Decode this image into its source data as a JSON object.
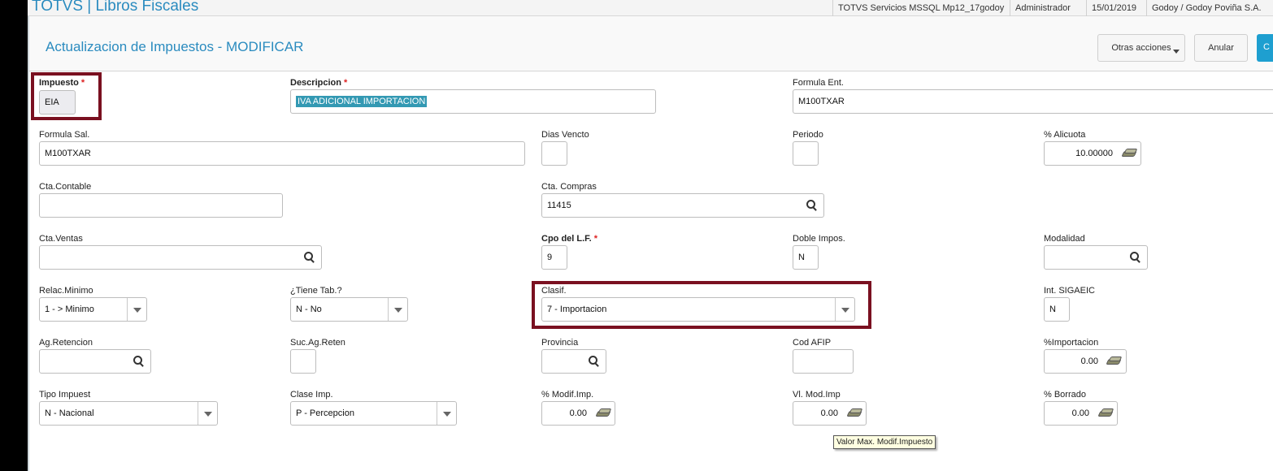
{
  "app": {
    "title": "TOTVS | Libros Fiscales",
    "server": "TOTVS Servicios MSSQL Mp12_17godoy",
    "user": "Administrador",
    "date": "15/01/2019",
    "company": "Godoy / Godoy Poviña S.A."
  },
  "header": {
    "title": "Actualizacion de Impuestos - MODIFICAR",
    "other_actions": "Otras acciones",
    "cancel": "Anular",
    "confirm": "C"
  },
  "form": {
    "impuesto": {
      "label": "Impuesto",
      "value": "EIA"
    },
    "descripcion": {
      "label": "Descripcion",
      "value": "IVA ADICIONAL IMPORTACION"
    },
    "formula_ent": {
      "label": "Formula Ent.",
      "value": "M100TXAR"
    },
    "formula_sal": {
      "label": "Formula Sal.",
      "value": "M100TXAR"
    },
    "dias_vencto": {
      "label": "Dias Vencto",
      "value": ""
    },
    "periodo": {
      "label": "Periodo",
      "value": ""
    },
    "alicuota": {
      "label": "% Alicuota",
      "value": "10.00000"
    },
    "cta_contable": {
      "label": "Cta.Contable",
      "value": ""
    },
    "cta_compras": {
      "label": "Cta. Compras",
      "value": "11415"
    },
    "cta_ventas": {
      "label": "Cta.Ventas",
      "value": ""
    },
    "cpo_lf": {
      "label": "Cpo del L.F.",
      "value": "9"
    },
    "doble_impos": {
      "label": "Doble Impos.",
      "value": "N"
    },
    "modalidad": {
      "label": "Modalidad",
      "value": ""
    },
    "relac_minimo": {
      "label": "Relac.Minimo",
      "value": "1 -  > Minimo"
    },
    "tiene_tab": {
      "label": "¿Tiene Tab.?",
      "value": "N -  No"
    },
    "clasif": {
      "label": "Clasif.",
      "value": "7 - Importacion"
    },
    "int_sigaeic": {
      "label": "Int. SIGAEIC",
      "value": "N"
    },
    "ag_retencion": {
      "label": "Ag.Retencion",
      "value": ""
    },
    "suc_ag_reten": {
      "label": "Suc.Ag.Reten",
      "value": ""
    },
    "provincia": {
      "label": "Provincia",
      "value": ""
    },
    "cod_afip": {
      "label": "Cod AFIP",
      "value": ""
    },
    "importacion": {
      "label": "%Importacion",
      "value": "0.00"
    },
    "tipo_impuest": {
      "label": "Tipo Impuest",
      "value": "N - Nacional"
    },
    "clase_imp": {
      "label": "Clase Imp.",
      "value": "P - Percepcion"
    },
    "modif_imp": {
      "label": "% Modif.Imp.",
      "value": "0.00"
    },
    "vl_mod_imp": {
      "label": "Vl. Mod.Imp",
      "value": "0.00"
    },
    "borrado": {
      "label": "% Borrado",
      "value": "0.00"
    }
  },
  "required_mark": "*",
  "tooltip": "Valor Max. Modif.Impuesto",
  "colors": {
    "accent": "#2a8bbf",
    "highlight_border": "#7a1020",
    "selection": "#3399b3"
  }
}
